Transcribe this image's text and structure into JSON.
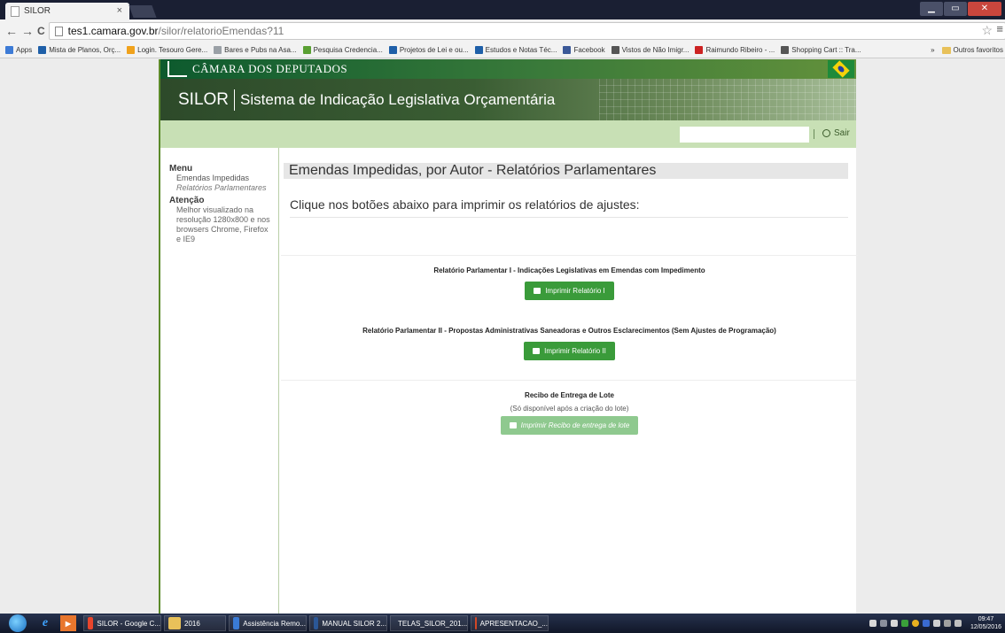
{
  "browser": {
    "tab_title": "SILOR",
    "tab_close": "×",
    "back": "←",
    "forward": "→",
    "reload": "C",
    "url_host": "tes1.camara.gov.br",
    "url_path": "/silor/relatorioEmendas?11",
    "star": "☆",
    "menu": "≡",
    "window_controls": {
      "minimize": "▁",
      "maximize": "▭",
      "close": "✕"
    }
  },
  "bookmarks": {
    "items": [
      {
        "label": "Apps",
        "color": "#3d7bd6"
      },
      {
        "label": "Mista de Planos, Orç...",
        "color": "#1e5fa8"
      },
      {
        "label": "Login. Tesouro Gere...",
        "color": "#f0a21c"
      },
      {
        "label": "Bares e Pubs na Asa...",
        "color": "#9aa0a6"
      },
      {
        "label": "Pesquisa Credencia...",
        "color": "#5aa033"
      },
      {
        "label": "Projetos de Lei e ou...",
        "color": "#1e5fa8"
      },
      {
        "label": "Estudos e Notas Téc...",
        "color": "#1e5fa8"
      },
      {
        "label": "Facebook",
        "color": "#3b5998"
      },
      {
        "label": "Vistos de Não Imigr...",
        "color": "#555555"
      },
      {
        "label": "Raimundo Ribeiro - ...",
        "color": "#cc2222"
      },
      {
        "label": "Shopping Cart :: Tra...",
        "color": "#555555"
      }
    ],
    "more": "»",
    "other": "Outros favoritos"
  },
  "header": {
    "camara_title": "CÂMARA DOS DEPUTADOS",
    "app_name": "SILOR",
    "app_full_name": "Sistema de Indicação Legislativa Orçamentária",
    "logout_label": "Sair"
  },
  "sidebar": {
    "menu_title": "Menu",
    "items": [
      {
        "label": "Emendas Impedidas"
      },
      {
        "label": "Relatórios Parlamentares"
      }
    ],
    "attention_title": "Atenção",
    "attention_text": "Melhor visualizado na resolução 1280x800 e nos browsers Chrome, Firefox e IE9"
  },
  "main": {
    "title": "Emendas Impedidas, por Autor - Relatórios Parlamentares",
    "intro": "Clique nos botões abaixo para imprimir os relatórios de ajustes:",
    "reports": [
      {
        "title": "Relatório Parlamentar I - Indicações Legislativas em Emendas com Impedimento",
        "button": "Imprimir Relatório I"
      },
      {
        "title": "Relatório Parlamentar II - Propostas Administrativas Saneadoras e Outros Esclarecimentos (Sem Ajustes de Programação)",
        "button": "Imprimir Relatório II"
      },
      {
        "title": "Recibo de Entrega de Lote",
        "note": "(Só disponível após a criação do lote)",
        "button": "Imprimir Recibo de entrega de lote"
      }
    ]
  },
  "taskbar": {
    "tasks": [
      {
        "label": "SILOR - Google C...",
        "color": "#e8452c"
      },
      {
        "label": "2016",
        "color": "#e8c15a"
      },
      {
        "label": "Assistência Remo...",
        "color": "#3a7bd5"
      },
      {
        "label": "MANUAL SILOR 2...",
        "color": "#2b5797"
      },
      {
        "label": "TELAS_SILOR_201...",
        "color": "#2b5797"
      },
      {
        "label": "APRESENTACAO_...",
        "color": "#d24726"
      }
    ],
    "time": "09:47",
    "date": "12/05/2016"
  }
}
